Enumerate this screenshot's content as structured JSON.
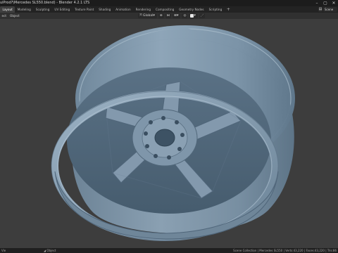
{
  "window": {
    "title": "ulProd?\\Mercedes SL550.blend) - Blender 4.2.1 LTS",
    "controls": [
      "minimize-icon",
      "maximize-icon",
      "close-icon"
    ]
  },
  "workspace_tabs": [
    "Layout",
    "Modeling",
    "Sculpting",
    "UV Editing",
    "Texture Paint",
    "Shading",
    "Animation",
    "Rendering",
    "Compositing",
    "Geometry Nodes",
    "Scripting",
    "+"
  ],
  "active_workspace": "Layout",
  "scene": {
    "name": "Scene"
  },
  "header_menu": [
    "ect",
    "Object"
  ],
  "transform": {
    "orientation": "Global"
  },
  "statusbar": {
    "left1": "Vie",
    "left2": "Object",
    "stats": "Scene Collection | Mercedes SL550 | Verts:43,220 | Faces:43,220 | Tris:86"
  },
  "colors": {
    "rim_body": "#7f96aa",
    "background": "#3d3d3d",
    "titlebar": "#1c1c1c"
  }
}
